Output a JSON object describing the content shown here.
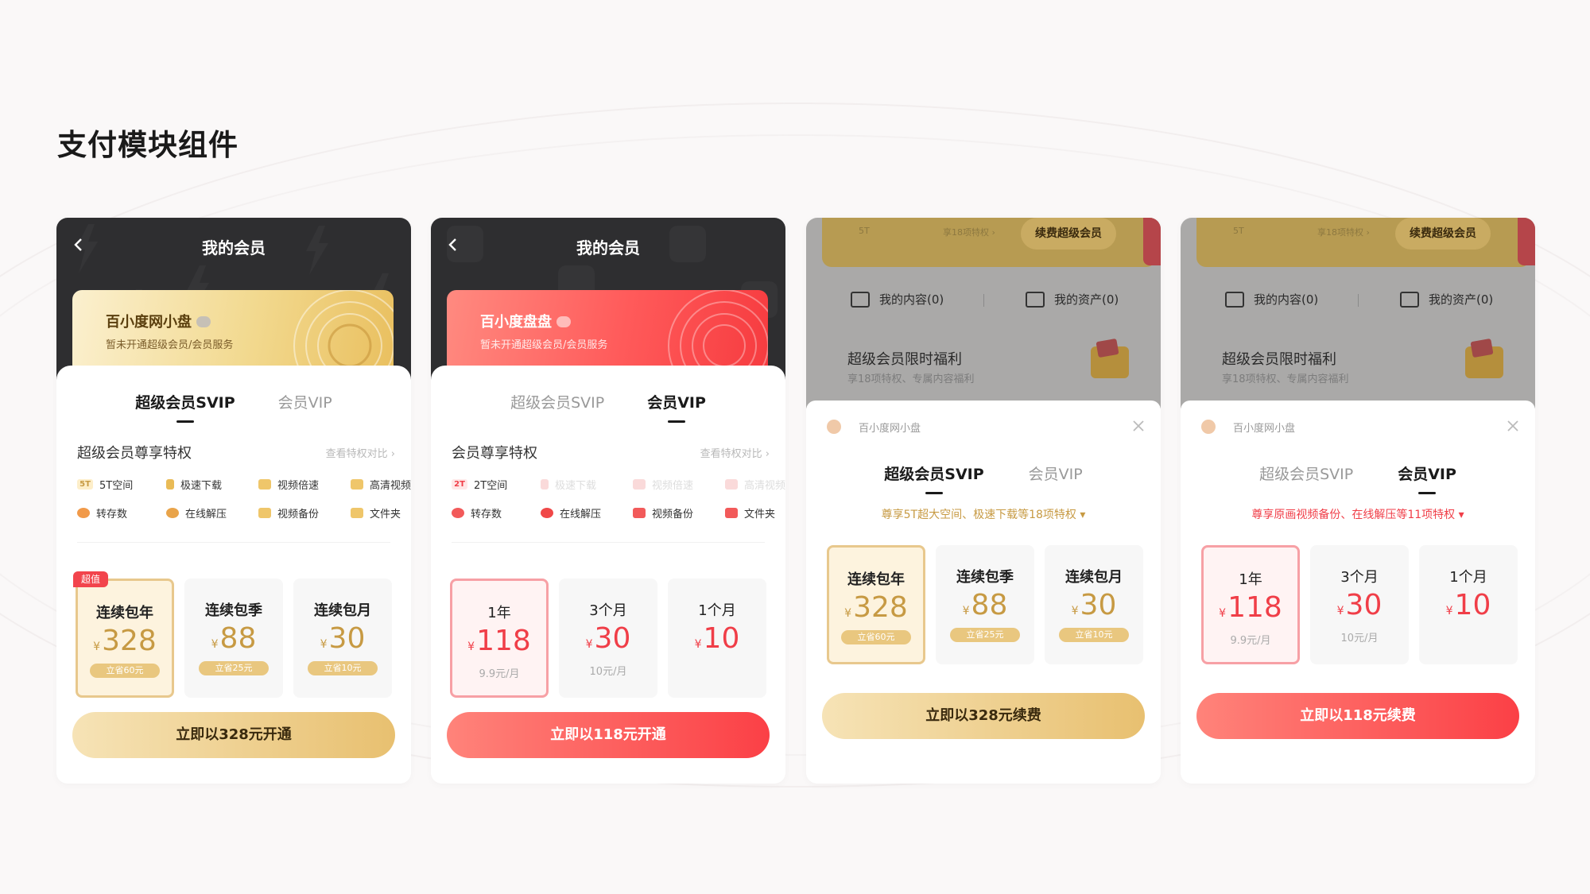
{
  "page": {
    "title": "支付模块组件"
  },
  "cards": [
    {
      "nav_title": "我的会员",
      "member_card": {
        "name": "百小度网小盘",
        "sub": "暂未开通超级会员/会员服务"
      },
      "tabs": [
        {
          "label": "超级会员SVIP",
          "active": true
        },
        {
          "label": "会员VIP",
          "active": false
        }
      ],
      "section_title": "超级会员尊享特权",
      "section_link": "查看特权对比 ›",
      "features_row1": [
        "5T空间",
        "极速下载",
        "视频倍速",
        "高清视频"
      ],
      "features_row2": [
        "转存数",
        "在线解压",
        "视频备份",
        "文件夹"
      ],
      "feature_badge": "5T",
      "plans": [
        {
          "name": "连续包年",
          "price": "328",
          "currency": "¥",
          "save": "立省60元",
          "tag": "超值"
        },
        {
          "name": "连续包季",
          "price": "88",
          "currency": "¥",
          "save": "立省25元"
        },
        {
          "name": "连续包月",
          "price": "30",
          "currency": "¥",
          "save": "立省10元"
        }
      ],
      "cta": "立即以328元开通"
    },
    {
      "nav_title": "我的会员",
      "member_card": {
        "name": "百小度盘盘",
        "sub": "暂未开通超级会员/会员服务"
      },
      "tabs": [
        {
          "label": "超级会员SVIP",
          "active": false
        },
        {
          "label": "会员VIP",
          "active": true
        }
      ],
      "section_title": "会员尊享特权",
      "section_link": "查看特权对比 ›",
      "features_row1": [
        "2T空间",
        "极速下载",
        "视频倍速",
        "高清视频"
      ],
      "features_row2": [
        "转存数",
        "在线解压",
        "视频备份",
        "文件夹"
      ],
      "feature_badge": "2T",
      "plans": [
        {
          "name": "1年",
          "price": "118",
          "currency": "¥",
          "note": "9.9元/月"
        },
        {
          "name": "3个月",
          "price": "30",
          "currency": "¥",
          "note": "10元/月"
        },
        {
          "name": "1个月",
          "price": "10",
          "currency": "¥"
        }
      ],
      "cta": "立即以118元开通"
    },
    {
      "overlay": {
        "tiny1": "5T",
        "tiny2": "享18项特权 ›",
        "renew": "续费超级会员",
        "content": "我的内容(0)",
        "assets": "我的资产(0)",
        "benefit": "超级会员限时福利",
        "benefit_sub": "享18项特权、专属内容福利"
      },
      "app_name": "百小度网小盘",
      "tabs": [
        {
          "label": "超级会员SVIP",
          "active": true
        },
        {
          "label": "会员VIP",
          "active": false
        }
      ],
      "promo": "尊享5T超大空间、极速下载等18项特权 ▾",
      "plans": [
        {
          "name": "连续包年",
          "price": "328",
          "currency": "¥",
          "save": "立省60元"
        },
        {
          "name": "连续包季",
          "price": "88",
          "currency": "¥",
          "save": "立省25元"
        },
        {
          "name": "连续包月",
          "price": "30",
          "currency": "¥",
          "save": "立省10元"
        }
      ],
      "cta": "立即以328元续费"
    },
    {
      "overlay": {
        "tiny1": "5T",
        "tiny2": "享18项特权 ›",
        "renew": "续费超级会员",
        "content": "我的内容(0)",
        "assets": "我的资产(0)",
        "benefit": "超级会员限时福利",
        "benefit_sub": "享18项特权、专属内容福利"
      },
      "app_name": "百小度网小盘",
      "tabs": [
        {
          "label": "超级会员SVIP",
          "active": false
        },
        {
          "label": "会员VIP",
          "active": true
        }
      ],
      "promo": "尊享原画视频备份、在线解压等11项特权 ▾",
      "plans": [
        {
          "name": "1年",
          "price": "118",
          "currency": "¥",
          "note": "9.9元/月"
        },
        {
          "name": "3个月",
          "price": "30",
          "currency": "¥",
          "note": "10元/月"
        },
        {
          "name": "1个月",
          "price": "10",
          "currency": "¥"
        }
      ],
      "cta": "立即以118元续费"
    }
  ],
  "colors": {
    "gold": "#c79a43",
    "red": "#f03e48",
    "dark_header": "#2e2e30"
  }
}
